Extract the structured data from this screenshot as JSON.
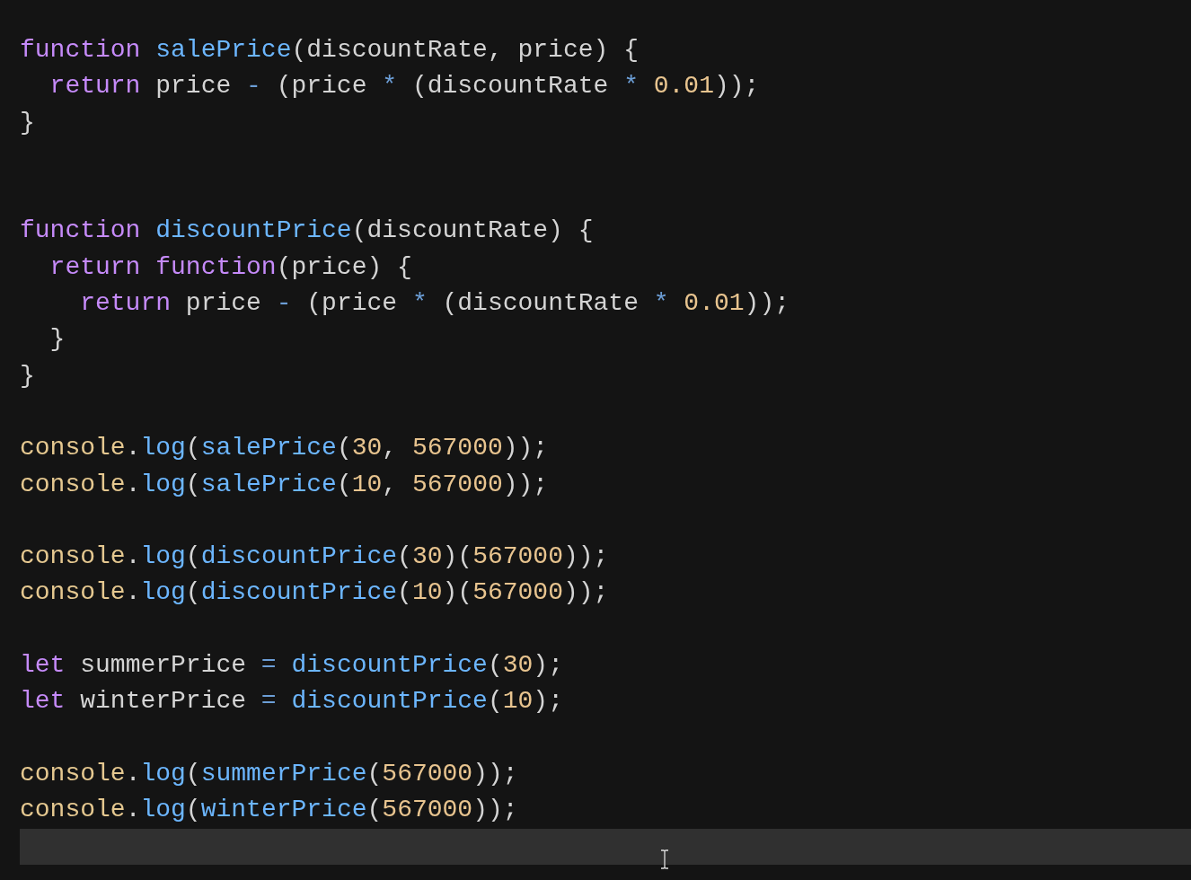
{
  "editor": {
    "lines": [
      {
        "current": false,
        "tokens": [
          {
            "text": "function ",
            "kind": "keyword"
          },
          {
            "text": "salePrice",
            "kind": "fn"
          },
          {
            "text": "(discountRate, price) {",
            "kind": "plain"
          }
        ]
      },
      {
        "current": false,
        "tokens": [
          {
            "text": "  return",
            "kind": "keyword"
          },
          {
            "text": " price ",
            "kind": "plain"
          },
          {
            "text": "-",
            "kind": "op"
          },
          {
            "text": " (price ",
            "kind": "plain"
          },
          {
            "text": "*",
            "kind": "op"
          },
          {
            "text": " (discountRate ",
            "kind": "plain"
          },
          {
            "text": "* ",
            "kind": "op"
          },
          {
            "text": "0.01",
            "kind": "num"
          },
          {
            "text": "));",
            "kind": "plain"
          }
        ]
      },
      {
        "current": false,
        "tokens": [
          {
            "text": "}",
            "kind": "plain"
          }
        ]
      },
      {
        "current": false
      },
      {
        "current": false
      },
      {
        "current": false,
        "tokens": [
          {
            "text": "function ",
            "kind": "keyword"
          },
          {
            "text": "discountPrice",
            "kind": "fn"
          },
          {
            "text": "(discountRate) {",
            "kind": "plain"
          }
        ]
      },
      {
        "current": false,
        "tokens": [
          {
            "text": "  return ",
            "kind": "keyword"
          },
          {
            "text": "function",
            "kind": "keyword"
          },
          {
            "text": "(price) {",
            "kind": "plain"
          }
        ]
      },
      {
        "current": false,
        "tokens": [
          {
            "text": "    return",
            "kind": "keyword"
          },
          {
            "text": " price ",
            "kind": "plain"
          },
          {
            "text": "-",
            "kind": "op"
          },
          {
            "text": " (price ",
            "kind": "plain"
          },
          {
            "text": "*",
            "kind": "op"
          },
          {
            "text": " (discountRate ",
            "kind": "plain"
          },
          {
            "text": "* ",
            "kind": "op"
          },
          {
            "text": "0.01",
            "kind": "num"
          },
          {
            "text": "));",
            "kind": "plain"
          }
        ]
      },
      {
        "current": false,
        "tokens": [
          {
            "text": "  }",
            "kind": "plain"
          }
        ]
      },
      {
        "current": false,
        "tokens": [
          {
            "text": "}",
            "kind": "plain"
          }
        ]
      },
      {
        "current": false
      },
      {
        "current": false,
        "tokens": [
          {
            "text": "console",
            "kind": "obj"
          },
          {
            "text": ".",
            "kind": "plain"
          },
          {
            "text": "log",
            "kind": "fn"
          },
          {
            "text": "(",
            "kind": "plain"
          },
          {
            "text": "salePrice",
            "kind": "fn"
          },
          {
            "text": "(",
            "kind": "plain"
          },
          {
            "text": "30",
            "kind": "num"
          },
          {
            "text": ", ",
            "kind": "plain"
          },
          {
            "text": "567000",
            "kind": "num"
          },
          {
            "text": "));",
            "kind": "plain"
          }
        ]
      },
      {
        "current": false,
        "tokens": [
          {
            "text": "console",
            "kind": "obj"
          },
          {
            "text": ".",
            "kind": "plain"
          },
          {
            "text": "log",
            "kind": "fn"
          },
          {
            "text": "(",
            "kind": "plain"
          },
          {
            "text": "salePrice",
            "kind": "fn"
          },
          {
            "text": "(",
            "kind": "plain"
          },
          {
            "text": "10",
            "kind": "num"
          },
          {
            "text": ", ",
            "kind": "plain"
          },
          {
            "text": "567000",
            "kind": "num"
          },
          {
            "text": "));",
            "kind": "plain"
          }
        ]
      },
      {
        "current": false
      },
      {
        "current": false,
        "tokens": [
          {
            "text": "console",
            "kind": "obj"
          },
          {
            "text": ".",
            "kind": "plain"
          },
          {
            "text": "log",
            "kind": "fn"
          },
          {
            "text": "(",
            "kind": "plain"
          },
          {
            "text": "discountPrice",
            "kind": "fn"
          },
          {
            "text": "(",
            "kind": "plain"
          },
          {
            "text": "30",
            "kind": "num"
          },
          {
            "text": ")(",
            "kind": "plain"
          },
          {
            "text": "567000",
            "kind": "num"
          },
          {
            "text": "));",
            "kind": "plain"
          }
        ]
      },
      {
        "current": false,
        "tokens": [
          {
            "text": "console",
            "kind": "obj"
          },
          {
            "text": ".",
            "kind": "plain"
          },
          {
            "text": "log",
            "kind": "fn"
          },
          {
            "text": "(",
            "kind": "plain"
          },
          {
            "text": "discountPrice",
            "kind": "fn"
          },
          {
            "text": "(",
            "kind": "plain"
          },
          {
            "text": "10",
            "kind": "num"
          },
          {
            "text": ")(",
            "kind": "plain"
          },
          {
            "text": "567000",
            "kind": "num"
          },
          {
            "text": "));",
            "kind": "plain"
          }
        ]
      },
      {
        "current": false
      },
      {
        "current": false,
        "tokens": [
          {
            "text": "let",
            "kind": "keyword"
          },
          {
            "text": " summerPrice ",
            "kind": "plain"
          },
          {
            "text": "= ",
            "kind": "op"
          },
          {
            "text": "discountPrice",
            "kind": "fn"
          },
          {
            "text": "(",
            "kind": "plain"
          },
          {
            "text": "30",
            "kind": "num"
          },
          {
            "text": ");",
            "kind": "plain"
          }
        ]
      },
      {
        "current": false,
        "tokens": [
          {
            "text": "let",
            "kind": "keyword"
          },
          {
            "text": " winterPrice ",
            "kind": "plain"
          },
          {
            "text": "= ",
            "kind": "op"
          },
          {
            "text": "discountPrice",
            "kind": "fn"
          },
          {
            "text": "(",
            "kind": "plain"
          },
          {
            "text": "10",
            "kind": "num"
          },
          {
            "text": ");",
            "kind": "plain"
          }
        ]
      },
      {
        "current": false
      },
      {
        "current": false,
        "tokens": [
          {
            "text": "console",
            "kind": "obj"
          },
          {
            "text": ".",
            "kind": "plain"
          },
          {
            "text": "log",
            "kind": "fn"
          },
          {
            "text": "(",
            "kind": "plain"
          },
          {
            "text": "summerPrice",
            "kind": "fn"
          },
          {
            "text": "(",
            "kind": "plain"
          },
          {
            "text": "567000",
            "kind": "num"
          },
          {
            "text": "));",
            "kind": "plain"
          }
        ]
      },
      {
        "current": false,
        "tokens": [
          {
            "text": "console",
            "kind": "obj"
          },
          {
            "text": ".",
            "kind": "plain"
          },
          {
            "text": "log",
            "kind": "fn"
          },
          {
            "text": "(",
            "kind": "plain"
          },
          {
            "text": "winterPrice",
            "kind": "fn"
          },
          {
            "text": "(",
            "kind": "plain"
          },
          {
            "text": "567000",
            "kind": "num"
          },
          {
            "text": "));",
            "kind": "plain"
          }
        ]
      },
      {
        "current": true
      }
    ]
  }
}
